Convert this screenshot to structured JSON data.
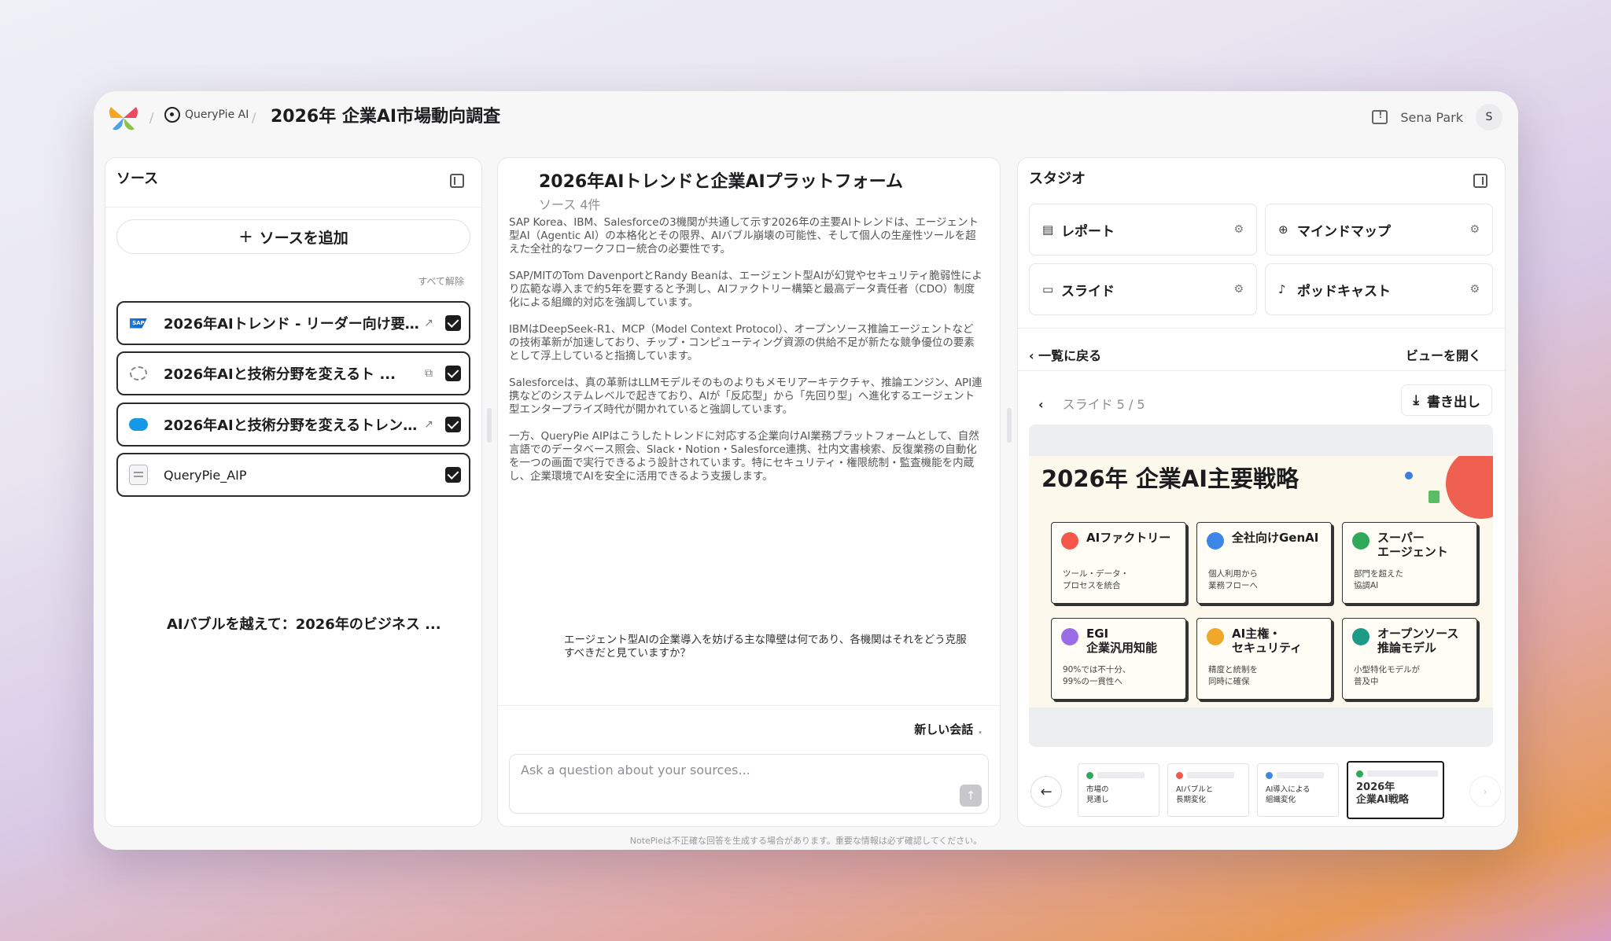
{
  "header": {
    "app_name": "QueryPie AI",
    "page_title": "2026年 企業AI市場動向調査",
    "user_name": "Sena Park",
    "user_initial": "S"
  },
  "sources_panel": {
    "title": "ソース",
    "add_source_label": "ソースを追加",
    "deselect_all_label": "すべて解除",
    "items": [
      {
        "title": "2026年AIトレンド - リーダー向け要点 ...",
        "icon": "sap-logo",
        "link_icon": "↗"
      },
      {
        "title": "2026年AIと技術分野を変えるト ...",
        "icon": "ibm-logo",
        "link_icon": "⧉"
      },
      {
        "title": "2026年AIと技術分野を変えるトレンド ...",
        "icon": "salesforce-logo",
        "link_icon": "↗"
      },
      {
        "title": "QueryPie_AIP",
        "icon": "document-icon",
        "link_icon": ""
      }
    ],
    "unchecked_item": "AIバブルを越えて：2026年のビジネス ..."
  },
  "chat_panel": {
    "title": "2026年AIトレンドと企業AIプラットフォーム",
    "source_count": "ソース 4件",
    "summary": [
      "SAP Korea、IBM、Salesforceの3機関が共通して示す2026年の主要AIトレンドは、エージェント型AI（Agentic AI）の本格化とその限界、AIバブル崩壊の可能性、そして個人の生産性ツールを超えた全社的なワークフロー統合の必要性です。",
      "SAP/MITのTom DavenportとRandy Beanは、エージェント型AIが幻覚やセキュリティ脆弱性により広範な導入まで約5年を要すると予測し、AIファクトリー構築と最高データ責任者（CDO）制度化による組織的対応を強調しています。",
      "IBMはDeepSeek-R1、MCP（Model Context Protocol）、オープンソース推論エージェントなどの技術革新が加速しており、チップ・コンピューティング資源の供給不足が新たな競争優位の要素として浮上していると指摘しています。",
      "Salesforceは、真の革新はLLMモデルそのものよりもメモリアーキテクチャ、推論エンジン、API連携などのシステムレベルで起きており、AIが「反応型」から「先回り型」へ進化するエージェント型エンタープライズ時代が開かれていると強調しています。",
      "一方、QueryPie AIPはこうしたトレンドに対応する企業向けAI業務プラットフォームとして、自然言語でのデータベース照会、Slack・Notion・Salesforce連携、社内文書検索、反復業務の自動化を一つの画面で実行できるよう設計されています。特にセキュリティ・権限統制・監査機能を内蔵し、企業環境でAIを安全に活用できるよう支援します。"
    ],
    "suggested_question": "エージェント型AIの企業導入を妨げる主な障壁は何であり、各機関はそれをどう克服すべきだと見ていますか？",
    "new_chat_label": "新しい会話",
    "input_placeholder": "Ask a question about your sources..."
  },
  "studio_panel": {
    "title": "スタジオ",
    "tools": [
      {
        "label": "レポート",
        "icon": "report-icon"
      },
      {
        "label": "マインドマップ",
        "icon": "mindmap-icon"
      },
      {
        "label": "スライド",
        "icon": "slides-icon"
      },
      {
        "label": "ポッドキャスト",
        "icon": "podcast-icon"
      }
    ],
    "back_label": "一覧に戻る",
    "open_view_label": "ビューを開く",
    "slide_counter": "スライド 5 / 5",
    "export_label": "書き出し",
    "slide": {
      "title": "2026年 企業AI主要戦略",
      "cards": [
        {
          "title": "AIファクトリー",
          "desc": "ツール・データ・\nプロセスを統合",
          "color": "#f2574a"
        },
        {
          "title": "全社向けGenAI",
          "desc": "個人利用から\n業務フローへ",
          "color": "#3d86e8"
        },
        {
          "title": "スーパー\nエージェント",
          "desc": "部門を超えた\n協調AI",
          "color": "#2fa85a"
        },
        {
          "title": "EGI\n企業汎用知能",
          "desc": "90%では不十分、\n99%の一貫性へ",
          "color": "#9a6ce8"
        },
        {
          "title": "AI主権・\nセキュリティ",
          "desc": "精度と統制を\n同時に確保",
          "color": "#f0a82a"
        },
        {
          "title": "オープンソース\n推論モデル",
          "desc": "小型特化モデルが\n普及中",
          "color": "#1f9a86"
        }
      ]
    },
    "thumbnails": [
      {
        "label": "市場の\n見通し",
        "color": "#2fa85a"
      },
      {
        "label": "AIバブルと\n長期変化",
        "color": "#f2574a"
      },
      {
        "label": "AI導入による\n組織変化",
        "color": "#3d86e8"
      },
      {
        "label": "2026年\n企業AI戦略",
        "color": "#2fa85a"
      }
    ]
  },
  "footer_note": "NotePieは不正確な回答を生成する場合があります。重要な情報は必ず確認してください。"
}
